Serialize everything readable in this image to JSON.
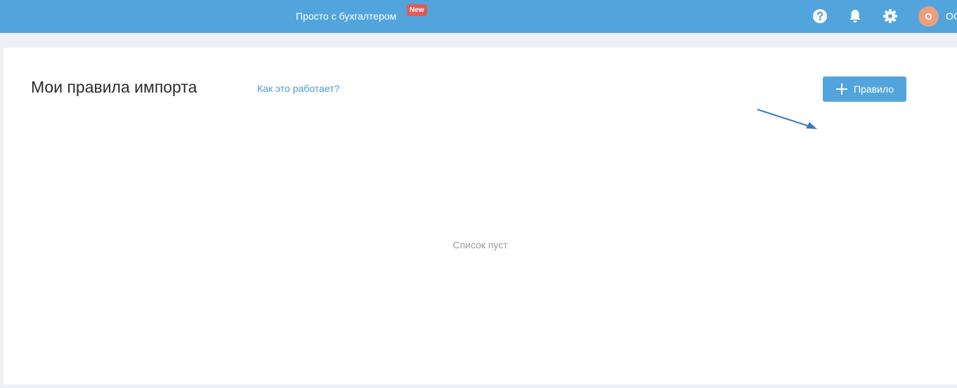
{
  "header": {
    "promo_link": "Просто с бухгалтером",
    "promo_badge": "New",
    "icons": [
      "help-icon",
      "bell-icon",
      "gear-icon"
    ],
    "avatar_initial": "О",
    "user_name": "ОО",
    "background_color": "#52a5dc"
  },
  "main": {
    "title": "Мои правила импорта",
    "help_link": "Как это работает?",
    "add_button_label": "Правило",
    "empty_state": "Список пуст"
  },
  "colors": {
    "accent": "#52a5dc",
    "badge": "#e05a59",
    "avatar": "#ee9e7d",
    "link": "#4d9bd1"
  }
}
